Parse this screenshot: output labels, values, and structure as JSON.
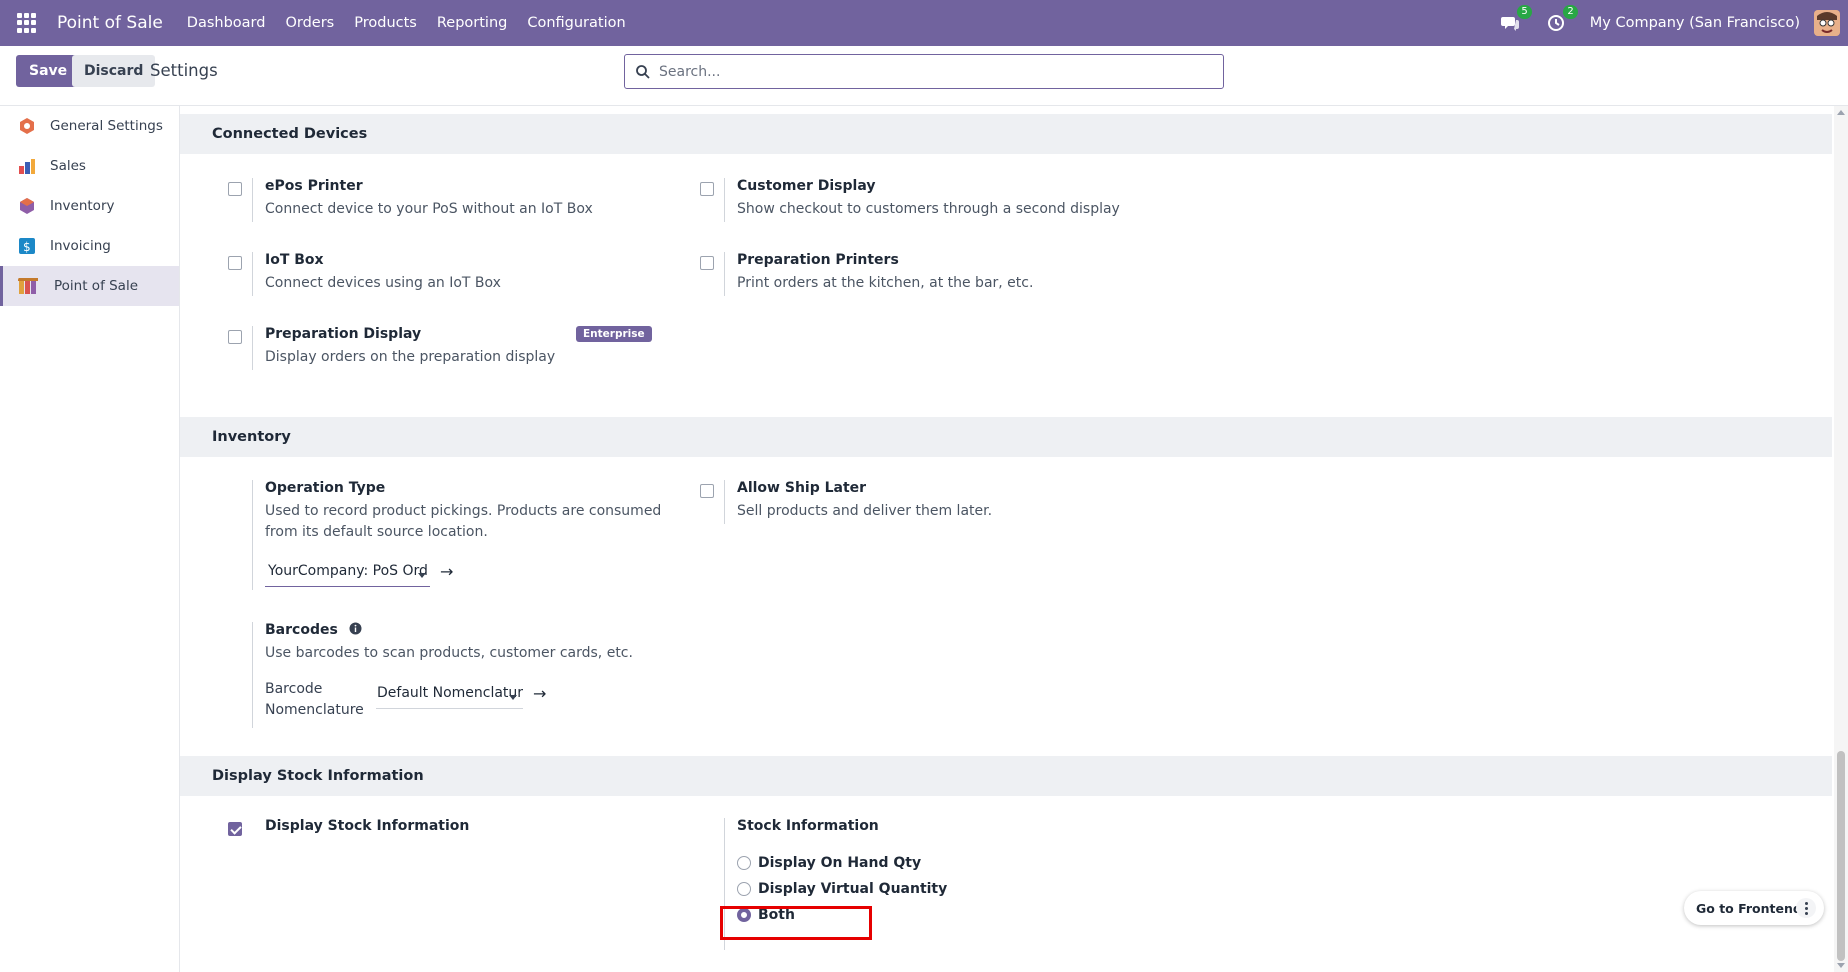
{
  "topnav": {
    "app_title": "Point of Sale",
    "menu": [
      "Dashboard",
      "Orders",
      "Products",
      "Reporting",
      "Configuration"
    ],
    "messages_count": "5",
    "activities_count": "2",
    "company": "My Company (San Francisco)"
  },
  "controlbar": {
    "save_label": "Save",
    "discard_label": "Discard",
    "title": "Settings",
    "search_placeholder": "Search..."
  },
  "sidebar": {
    "items": [
      {
        "label": "General Settings",
        "icon": "general-settings-icon",
        "color": "#e46f4a"
      },
      {
        "label": "Sales",
        "icon": "sales-icon",
        "color": "#e24e4e"
      },
      {
        "label": "Inventory",
        "icon": "inventory-icon",
        "color": "#8f5ea8"
      },
      {
        "label": "Invoicing",
        "icon": "invoicing-icon",
        "color": "#1c88c7"
      },
      {
        "label": "Point of Sale",
        "icon": "point-of-sale-icon",
        "color": "#e0a13d"
      }
    ],
    "active": "Point of Sale"
  },
  "sections": {
    "connected_devices": {
      "title": "Connected Devices",
      "epos_printer": {
        "title": "ePos Printer",
        "desc": "Connect device to your PoS without an IoT Box",
        "checked": false
      },
      "customer_display": {
        "title": "Customer Display",
        "desc": "Show checkout to customers through a second display",
        "checked": false
      },
      "iot_box": {
        "title": "IoT Box",
        "desc": "Connect devices using an IoT Box",
        "checked": false
      },
      "preparation_printers": {
        "title": "Preparation Printers",
        "desc": "Print orders at the kitchen, at the bar, etc.",
        "checked": false
      },
      "preparation_display": {
        "title": "Preparation Display",
        "desc": "Display orders on the preparation display",
        "checked": false,
        "badge": "Enterprise"
      }
    },
    "inventory": {
      "title": "Inventory",
      "operation_type": {
        "title": "Operation Type",
        "desc": "Used to record product pickings. Products are consumed from its default source location.",
        "value": "YourCompany: PoS Ord"
      },
      "allow_ship_later": {
        "title": "Allow Ship Later",
        "desc": "Sell products and deliver them later.",
        "checked": false
      },
      "barcodes": {
        "title": "Barcodes",
        "desc": "Use barcodes to scan products, customer cards, etc.",
        "field_label": "Barcode Nomenclature",
        "value": "Default Nomenclatur"
      }
    },
    "display_stock": {
      "title": "Display Stock Information",
      "checkbox_label": "Display Stock Information",
      "checked": true,
      "stock_info_title": "Stock Information",
      "options": [
        "Display On Hand Qty",
        "Display Virtual Quantity",
        "Both"
      ],
      "selected": "Both"
    }
  },
  "floating": {
    "go_to_frontend": "Go to Frontend"
  }
}
